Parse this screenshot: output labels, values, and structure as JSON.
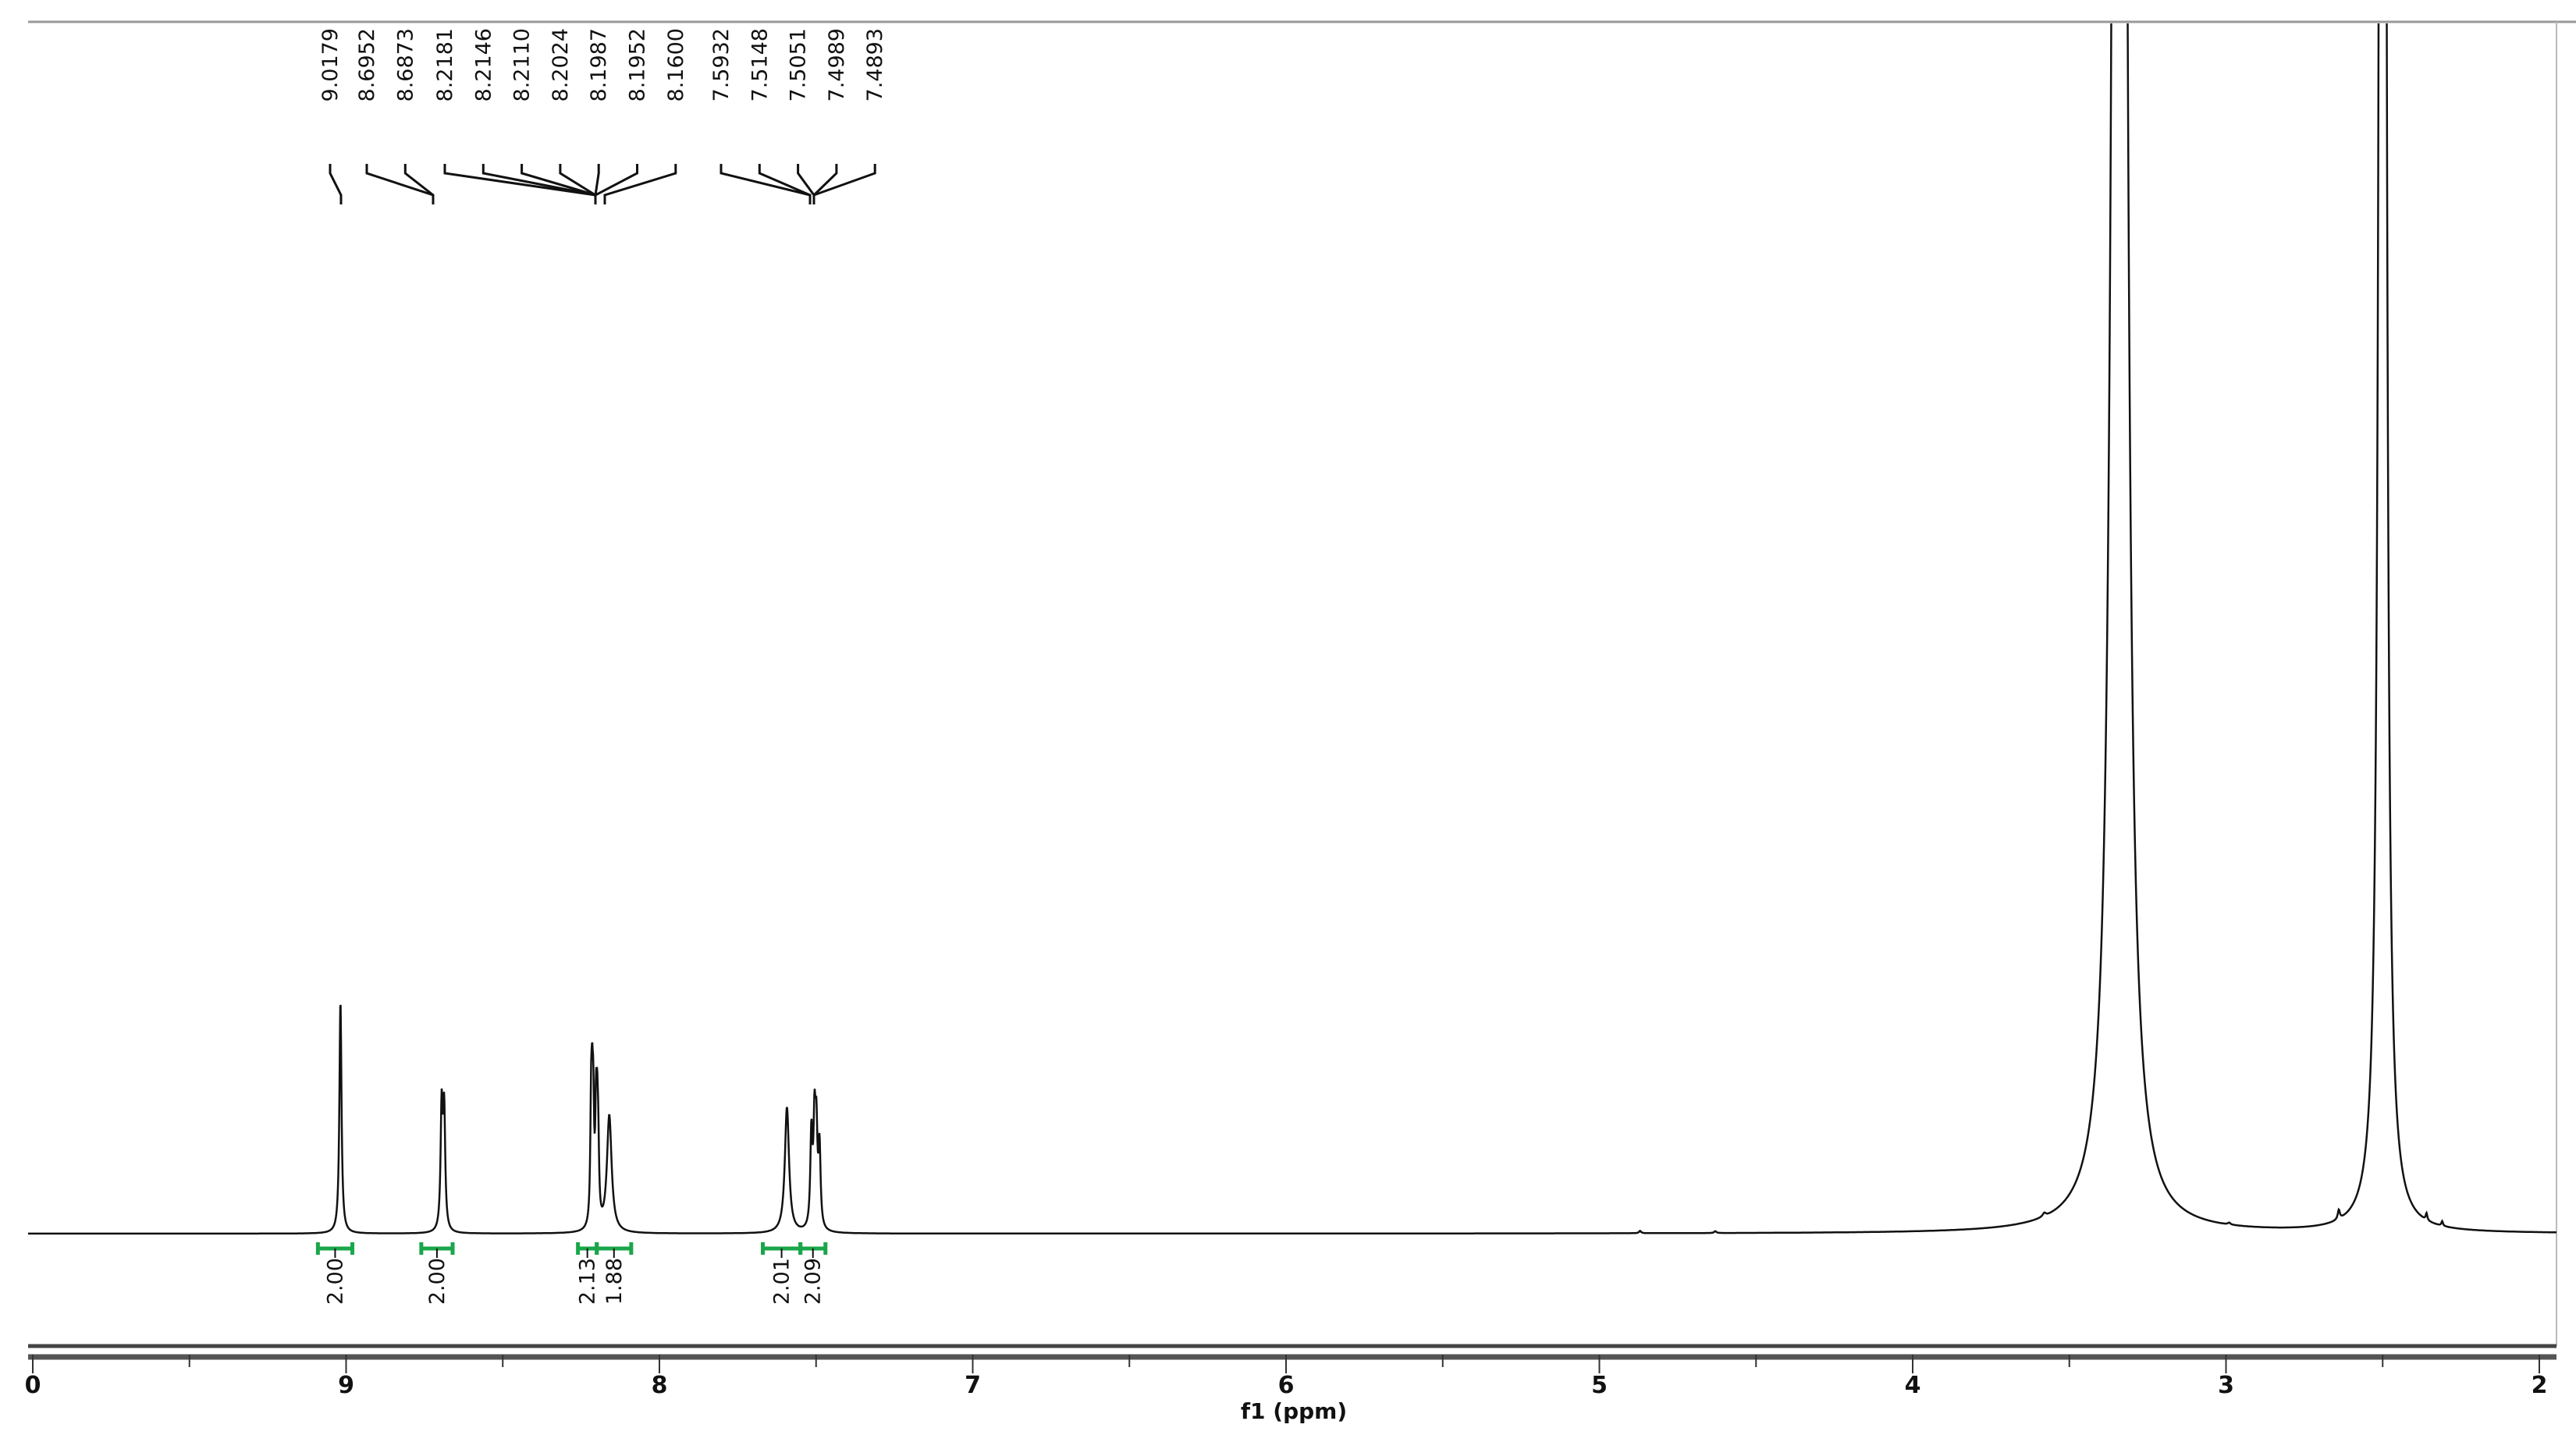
{
  "chart_data": {
    "type": "line",
    "title": "",
    "xlabel": "f1 (ppm)",
    "ylabel": "",
    "xlim": [
      10,
      1.95
    ],
    "ylim": [
      0,
      519
    ],
    "x_reversed": true,
    "grid": false,
    "x_ticks": [
      10,
      9,
      8,
      7,
      6,
      5,
      4,
      3,
      2
    ],
    "x_tick_labels": [
      "0",
      "9",
      "8",
      "7",
      "6",
      "5",
      "4",
      "3",
      "2"
    ],
    "peak_label_groups": [
      {
        "labels": [
          "9.0179"
        ]
      },
      {
        "labels": [
          "8.6952",
          "8.6873"
        ]
      },
      {
        "labels": [
          "8.2181",
          "8.2146",
          "8.2110",
          "8.2024",
          "8.1987",
          "8.1952",
          "8.1600"
        ]
      },
      {
        "labels": [
          "7.5932",
          "7.5148",
          "7.5051",
          "7.4989",
          "7.4893"
        ]
      }
    ],
    "peaks": [
      {
        "ppm": 9.018,
        "intensity": 100,
        "hw": 0.004
      },
      {
        "ppm": 8.695,
        "intensity": 52,
        "hw": 0.004
      },
      {
        "ppm": 8.687,
        "intensity": 50,
        "hw": 0.004
      },
      {
        "ppm": 8.218,
        "intensity": 45,
        "hw": 0.003
      },
      {
        "ppm": 8.2146,
        "intensity": 40,
        "hw": 0.003
      },
      {
        "ppm": 8.211,
        "intensity": 42,
        "hw": 0.003
      },
      {
        "ppm": 8.2024,
        "intensity": 40,
        "hw": 0.003
      },
      {
        "ppm": 8.1987,
        "intensity": 36,
        "hw": 0.003
      },
      {
        "ppm": 8.1952,
        "intensity": 28,
        "hw": 0.003
      },
      {
        "ppm": 8.16,
        "intensity": 50,
        "hw": 0.009
      },
      {
        "ppm": 7.593,
        "intensity": 54,
        "hw": 0.008
      },
      {
        "ppm": 7.515,
        "intensity": 40,
        "hw": 0.004
      },
      {
        "ppm": 7.505,
        "intensity": 42,
        "hw": 0.004
      },
      {
        "ppm": 7.499,
        "intensity": 38,
        "hw": 0.004
      },
      {
        "ppm": 7.489,
        "intensity": 34,
        "hw": 0.004
      },
      {
        "ppm": 4.87,
        "intensity": 1,
        "hw": 0.004
      },
      {
        "ppm": 4.63,
        "intensity": 0.8,
        "hw": 0.004
      },
      {
        "ppm": 3.58,
        "intensity": 1.5,
        "hw": 0.006
      },
      {
        "ppm": 3.34,
        "intensity": 3000,
        "hw": 0.012
      },
      {
        "ppm": 2.99,
        "intensity": 0.8,
        "hw": 0.005
      },
      {
        "ppm": 2.64,
        "intensity": 4,
        "hw": 0.004
      },
      {
        "ppm": 2.5,
        "intensity": 3000,
        "hw": 0.006
      },
      {
        "ppm": 2.36,
        "intensity": 3,
        "hw": 0.003
      },
      {
        "ppm": 2.31,
        "intensity": 2,
        "hw": 0.003
      }
    ],
    "integrals": [
      {
        "label": "2.00",
        "from": 9.09,
        "to": 8.98
      },
      {
        "label": "2.00",
        "from": 8.76,
        "to": 8.66
      },
      {
        "label": "2.13",
        "from": 8.26,
        "to": 8.2
      },
      {
        "label": "1.88",
        "from": 8.2,
        "to": 8.09
      },
      {
        "label": "2.01",
        "from": 7.67,
        "to": 7.55
      },
      {
        "label": "2.09",
        "from": 7.55,
        "to": 7.47
      }
    ],
    "colors": {
      "spectrum": "#111111",
      "integral": "#1aa64a",
      "axis": "#555555"
    }
  }
}
